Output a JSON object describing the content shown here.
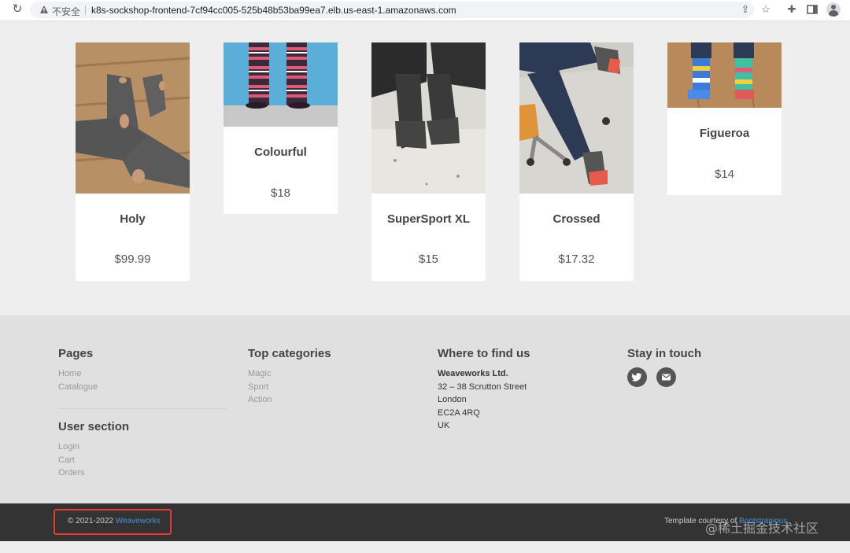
{
  "browser": {
    "security_label": "不安全",
    "url": "k8s-sockshop-frontend-7cf94cc005-525b48b53ba99ea7.elb.us-east-1.amazonaws.com"
  },
  "products": [
    {
      "name": "Holy",
      "price": "$99.99"
    },
    {
      "name": "Colourful",
      "price": "$18"
    },
    {
      "name": "SuperSport XL",
      "price": "$15"
    },
    {
      "name": "Crossed",
      "price": "$17.32"
    },
    {
      "name": "Figueroa",
      "price": "$14"
    }
  ],
  "footer": {
    "pages": {
      "title": "Pages",
      "links": [
        "Home",
        "Catalogue"
      ]
    },
    "user_section": {
      "title": "User section",
      "links": [
        "Login",
        "Cart",
        "Orders"
      ]
    },
    "top_categories": {
      "title": "Top categories",
      "links": [
        "Magic",
        "Sport",
        "Action"
      ]
    },
    "find_us": {
      "title": "Where to find us",
      "company": "Weaveworks Ltd.",
      "lines": [
        "32 – 38 Scrutton Street",
        "London",
        "EC2A 4RQ",
        "UK"
      ]
    },
    "stay_in_touch": {
      "title": "Stay in touch",
      "icons": [
        "twitter-icon",
        "email-icon"
      ]
    }
  },
  "copyright": {
    "text": "© 2021-2022 ",
    "link": "Weaveworks"
  },
  "courtesy": {
    "text": "Template courtesy of ",
    "link": "Bootstrapious"
  },
  "watermark": "@稀土掘金技术社区",
  "colors": {
    "link_blue": "#4a90d9",
    "highlight_red": "#e53935",
    "footer_bg": "#e0e0e0",
    "copyright_bg": "#333333"
  }
}
